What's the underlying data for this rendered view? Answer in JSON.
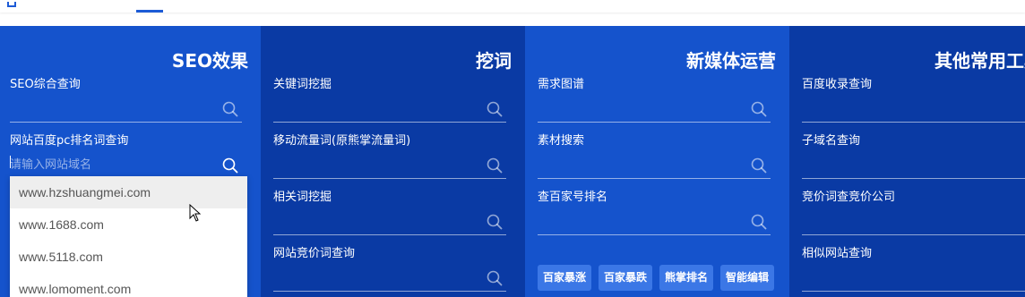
{
  "columns": [
    {
      "title": "SEO效果",
      "fields": [
        {
          "label": "SEO综合查询"
        },
        {
          "label": "网站百度pc排名词查询",
          "placeholder": "请输入网站域名"
        }
      ],
      "dropdown": [
        "www.hzshuangmei.com",
        "www.1688.com",
        "www.5118.com",
        "www.lomoment.com"
      ]
    },
    {
      "title": "挖词",
      "fields": [
        {
          "label": "关键词挖掘"
        },
        {
          "label": "移动流量词(原熊掌流量词)"
        },
        {
          "label": "相关词挖掘"
        },
        {
          "label": "网站竞价词查询"
        }
      ]
    },
    {
      "title": "新媒体运营",
      "fields": [
        {
          "label": "需求图谱"
        },
        {
          "label": "素材搜索"
        },
        {
          "label": "查百家号排名"
        }
      ],
      "tags": [
        "百家暴涨",
        "百家暴跌",
        "熊掌排名",
        "智能编辑"
      ]
    },
    {
      "title": "其他常用工具",
      "fields": [
        {
          "label": "百度收录查询"
        },
        {
          "label": "子域名查询"
        },
        {
          "label": "竞价词查竞价公司"
        },
        {
          "label": "相似网站查询"
        }
      ]
    }
  ],
  "colors": {
    "panel_light": "#1553cc",
    "panel_dark": "#0a3aa4",
    "tag_bg": "#3b77e6",
    "accent": "#1d5bd6"
  }
}
